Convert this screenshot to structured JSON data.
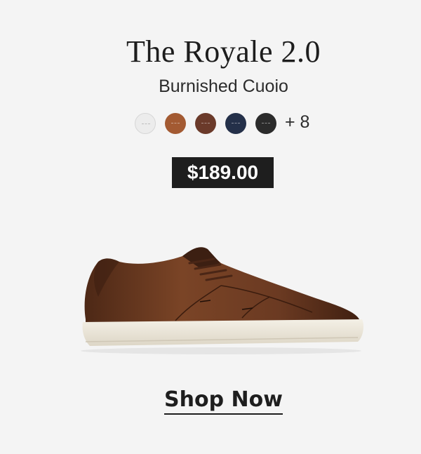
{
  "product": {
    "name": "The Royale 2.0",
    "colorway": "Burnished Cuoio",
    "price": "$189.00"
  },
  "swatches": {
    "items": [
      {
        "name": "white",
        "color": "#ececec"
      },
      {
        "name": "cuoio",
        "color": "#a35a32"
      },
      {
        "name": "brown",
        "color": "#6b3a2a"
      },
      {
        "name": "navy",
        "color": "#243049"
      },
      {
        "name": "black",
        "color": "#2b2b2b"
      }
    ],
    "more_label": "+ 8"
  },
  "image": {
    "icon": "sneaker-image",
    "leather_color": "#6b3a22",
    "sole_color": "#efeadf"
  },
  "cta": {
    "label": "Shop Now"
  }
}
